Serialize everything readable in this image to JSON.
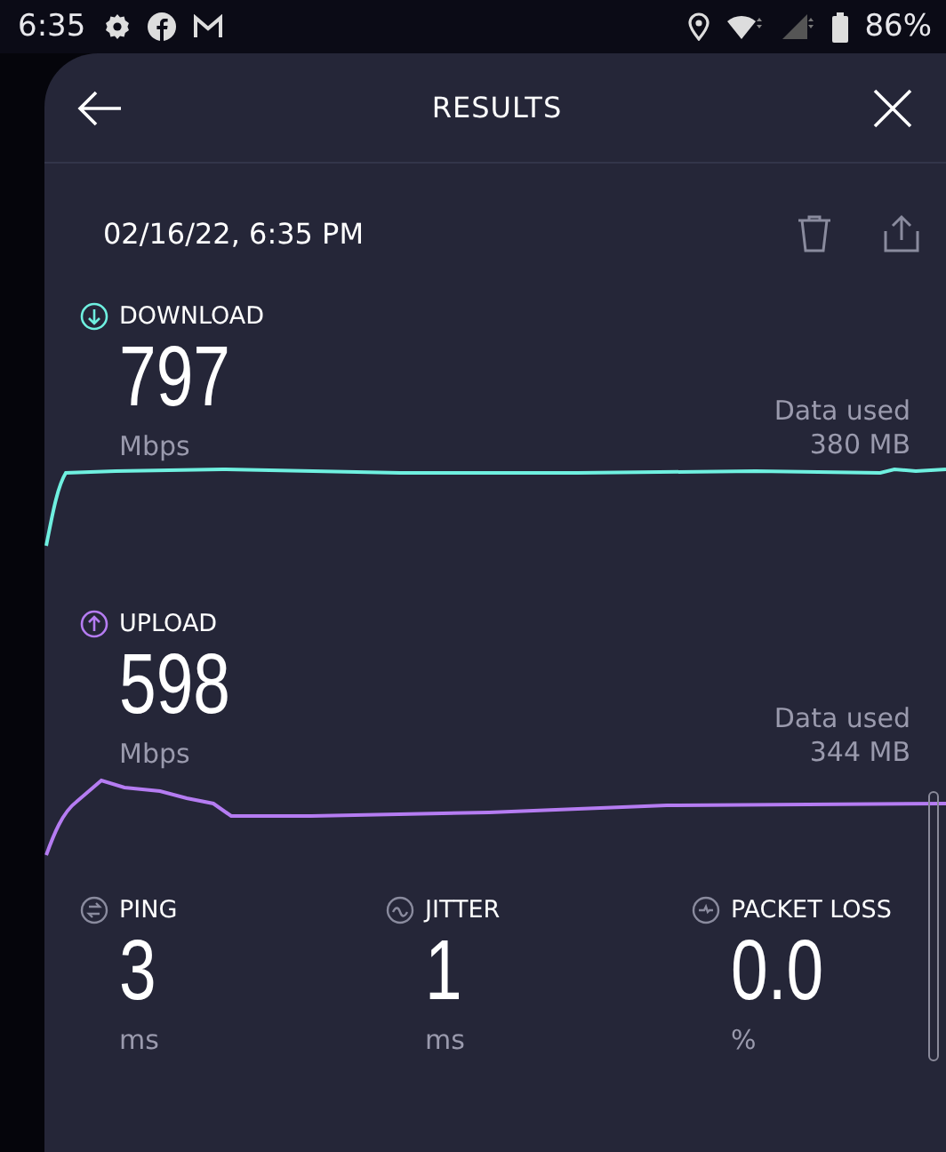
{
  "status_bar": {
    "time": "6:35",
    "battery": "86%"
  },
  "header": {
    "title": "RESULTS"
  },
  "test": {
    "date": "02/16/22, 6:35 PM"
  },
  "speeds": [
    {
      "kind": "download",
      "label": "DOWNLOAD",
      "value": "797",
      "unit": "Mbps",
      "data_label": "Data used",
      "data_value": "380 MB",
      "color": "#6ff0e0"
    },
    {
      "kind": "upload",
      "label": "UPLOAD",
      "value": "598",
      "unit": "Mbps",
      "data_label": "Data used",
      "data_value": "344 MB",
      "color": "#b57cf2"
    }
  ],
  "stats": [
    {
      "kind": "ping",
      "label": "PING",
      "value": "3",
      "unit": "ms"
    },
    {
      "kind": "jitter",
      "label": "JITTER",
      "value": "1",
      "unit": "ms"
    },
    {
      "kind": "packet_loss",
      "label": "PACKET LOSS",
      "value": "0.0",
      "unit": "%"
    }
  ]
}
